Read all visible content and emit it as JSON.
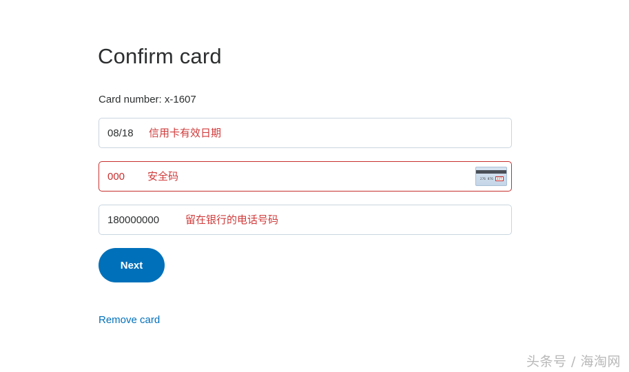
{
  "page": {
    "title": "Confirm card",
    "card_number_label": "Card number: x-1607"
  },
  "fields": {
    "expiry": {
      "value": "08/18",
      "annotation": "信用卡有效日期"
    },
    "cvv": {
      "value": "000",
      "annotation": "安全码",
      "state": "error",
      "card_digits": "276 876",
      "card_code": "337"
    },
    "phone": {
      "value": "180000000",
      "annotation": "留在银行的电话号码"
    }
  },
  "actions": {
    "next_label": "Next",
    "remove_label": "Remove card"
  },
  "watermark": "头条号 / 海淘网",
  "colors": {
    "accent": "#0070ba",
    "error": "#c72e2e",
    "annotation": "#d03a3a",
    "border": "#c9d5df"
  }
}
